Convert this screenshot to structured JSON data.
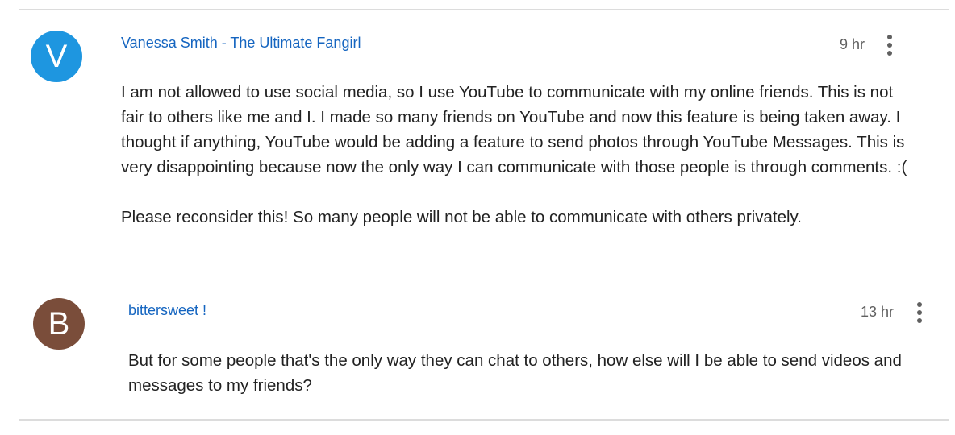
{
  "colors": {
    "avatar_1": "#1e96e0",
    "avatar_2": "#7a4d3a",
    "author_link": "#1565c0",
    "body_text": "#222222",
    "divider": "#dcdcdc"
  },
  "comments": [
    {
      "avatar_letter": "V",
      "author": "Vanessa Smith - The Ultimate Fangirl",
      "time": "9 hr",
      "menu_icon": "more-vert-icon",
      "paragraphs": [
        "I am not allowed to use social media, so I use YouTube to communicate with my online friends. This is not fair to others like me and I. I made so many friends on YouTube and now this feature is being taken away. I thought if anything, YouTube would be adding a feature to send photos through YouTube Messages. This is very disappointing because now the only way I can communicate with those people is through comments. :(",
        "Please reconsider this! So many people will not be able to communicate with others privately."
      ]
    },
    {
      "avatar_letter": "B",
      "author": "bittersweet !",
      "time": "13 hr",
      "menu_icon": "more-vert-icon",
      "paragraphs": [
        "But for some people that's the only way they can chat to others, how else will I be able to send videos and messages to my friends?"
      ]
    }
  ]
}
